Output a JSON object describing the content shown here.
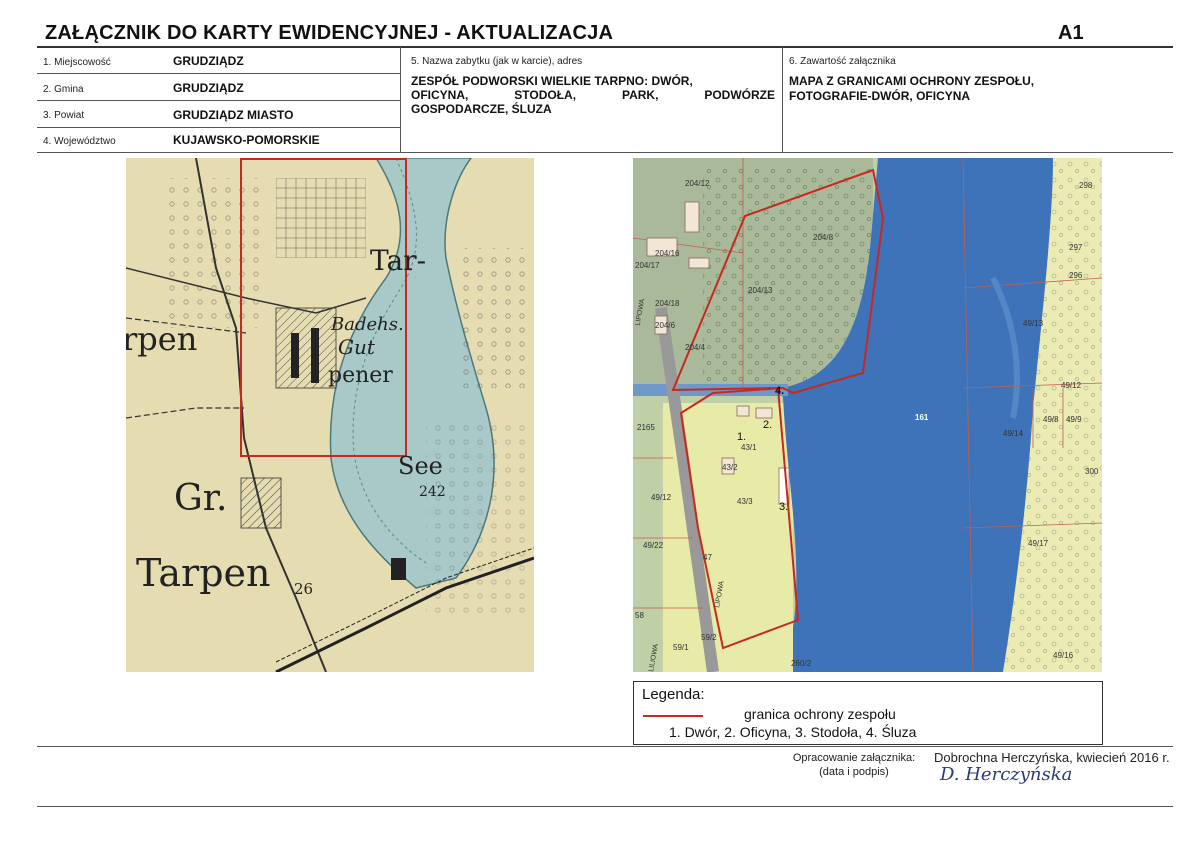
{
  "header": {
    "title": "ZAŁĄCZNIK DO KARTY EWIDENCYJNEJ - AKTUALIZACJA",
    "code": "A1"
  },
  "fields": [
    {
      "label": "1. Miejscowość",
      "value": "GRUDZIĄDZ"
    },
    {
      "label": "2. Gmina",
      "value": "GRUDZIĄDZ"
    },
    {
      "label": "3. Powiat",
      "value": "GRUDZIĄDZ MIASTO"
    },
    {
      "label": "4. Województwo",
      "value": "KUJAWSKO-POMORSKIE"
    }
  ],
  "monument": {
    "label": "5. Nazwa zabytku (jak w karcie), adres",
    "lines": [
      "ZESPÓŁ PODWORSKI WIELKIE TARPNO: DWÓR,",
      "OFICYNA, STODOŁA, PARK, PODWÓRZE",
      "GOSPODARCZE, ŚLUZA"
    ]
  },
  "contents": {
    "label": "6. Zawartość załącznika",
    "lines": [
      "MAPA Z GRANICAMI OCHRONY ZESPOŁU,",
      "FOTOGRAFIE-DWÓR, OFICYNA"
    ]
  },
  "old_map": {
    "labels": {
      "tar": "Tar-",
      "pen": "rpen",
      "badehs": "Badehs.",
      "gut": "Gut",
      "pener": "pener",
      "see": "See",
      "see_num": "242",
      "gr": "Gr.",
      "tarpen": "Tarpen",
      "tarpen_num": "26"
    }
  },
  "cadastral_map": {
    "parcels": [
      "204/12",
      "204/8",
      "204/13",
      "204/16",
      "204/17",
      "204/18",
      "204/6",
      "204/4",
      "161",
      "43/1",
      "43/2",
      "43/3",
      "49/13",
      "49/12",
      "49/14",
      "49/9",
      "49/8",
      "49/17",
      "49/16",
      "298",
      "297",
      "296",
      "300",
      "2165",
      "49/22",
      "49/12",
      "59/2",
      "59/1",
      "58",
      "260/2",
      "47"
    ],
    "streets": [
      "LIPOWA",
      "LIPOWA",
      "LILIOWA"
    ],
    "markers": [
      "1.",
      "2.",
      "3.",
      "4."
    ]
  },
  "legend": {
    "title": "Legenda:",
    "boundary_label": "granica ochrony zespołu",
    "items": "1.  Dwór, 2. Oficyna, 3. Stodoła, 4. Śluza",
    "boundary_color": "#c8281e"
  },
  "signature": {
    "label_line1": "Opracowanie załącznika:",
    "label_line2": "(data i podpis)",
    "author": "Dobrochna Herczyńska, kwiecień 2016 r.",
    "signature_text": "D. Herczyńska"
  }
}
